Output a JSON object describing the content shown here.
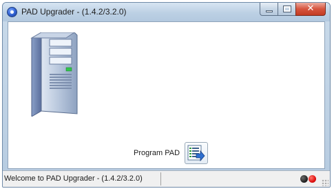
{
  "window": {
    "title": "PAD Upgrader - (1.4.2/3.2.0)",
    "minimize_label": "",
    "maximize_label": "",
    "close_label": "✕"
  },
  "main": {
    "device_icon": "server-tower-icon",
    "program_label": "Program PAD",
    "program_button_icon": "program-list-arrow-icon"
  },
  "statusbar": {
    "message": "Welcome to PAD Upgrader - (1.4.2/3.2.0)",
    "indicators": [
      "dark-led",
      "red-led"
    ]
  },
  "colors": {
    "titlebar": "#bcd0e4",
    "close_button": "#c23b22",
    "led_dark": "#1c1c1c",
    "led_red": "#e01010"
  }
}
